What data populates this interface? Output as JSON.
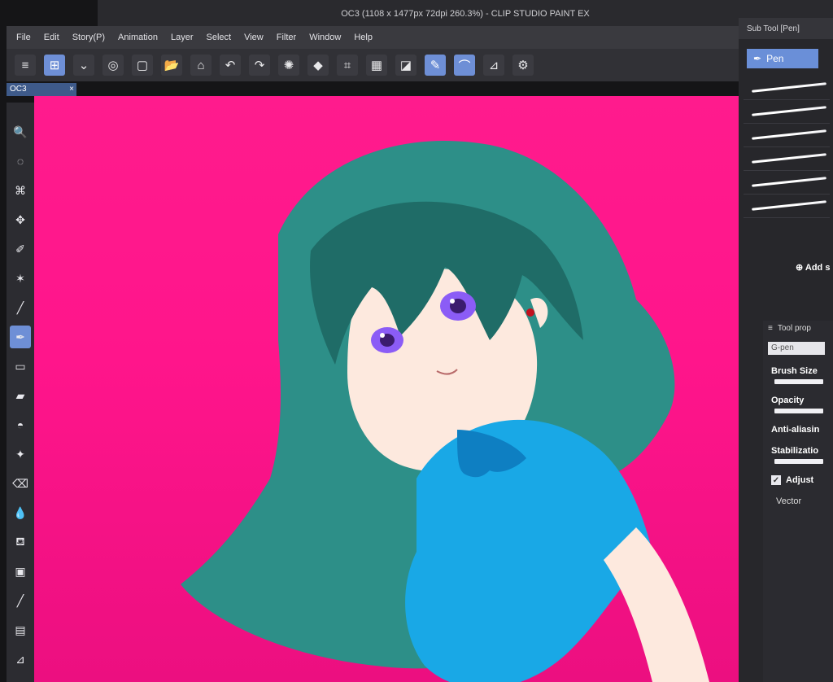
{
  "window": {
    "title": "OC3 (1108 x 1477px 72dpi 260.3%) - CLIP STUDIO PAINT EX",
    "tab_label": "OC3",
    "tab_close": "×"
  },
  "menu": {
    "items": [
      "File",
      "Edit",
      "Story(P)",
      "Animation",
      "Layer",
      "Select",
      "View",
      "Filter",
      "Window",
      "Help"
    ]
  },
  "right_panel": {
    "subtool_label": "Sub Tool [Pen]",
    "pen_tab": "Pen",
    "add_subtool": "Add s",
    "tool_prop_title": "Tool prop",
    "gpen_value": "G-pen",
    "properties": [
      {
        "label": "Brush Size"
      },
      {
        "label": "Opacity"
      },
      {
        "label": "Anti-aliasin"
      },
      {
        "label": "Stabilizatio"
      }
    ],
    "adjust_label": "Adjust",
    "vector_label": "Vector"
  },
  "icons": {
    "menu": "≡",
    "close": "×"
  },
  "colors": {
    "accent": "#6e8fd6",
    "canvas_bg": "#ff1b8d",
    "hair": "#2e8f88",
    "shirt": "#19a8e6",
    "skin": "#fde9de"
  }
}
